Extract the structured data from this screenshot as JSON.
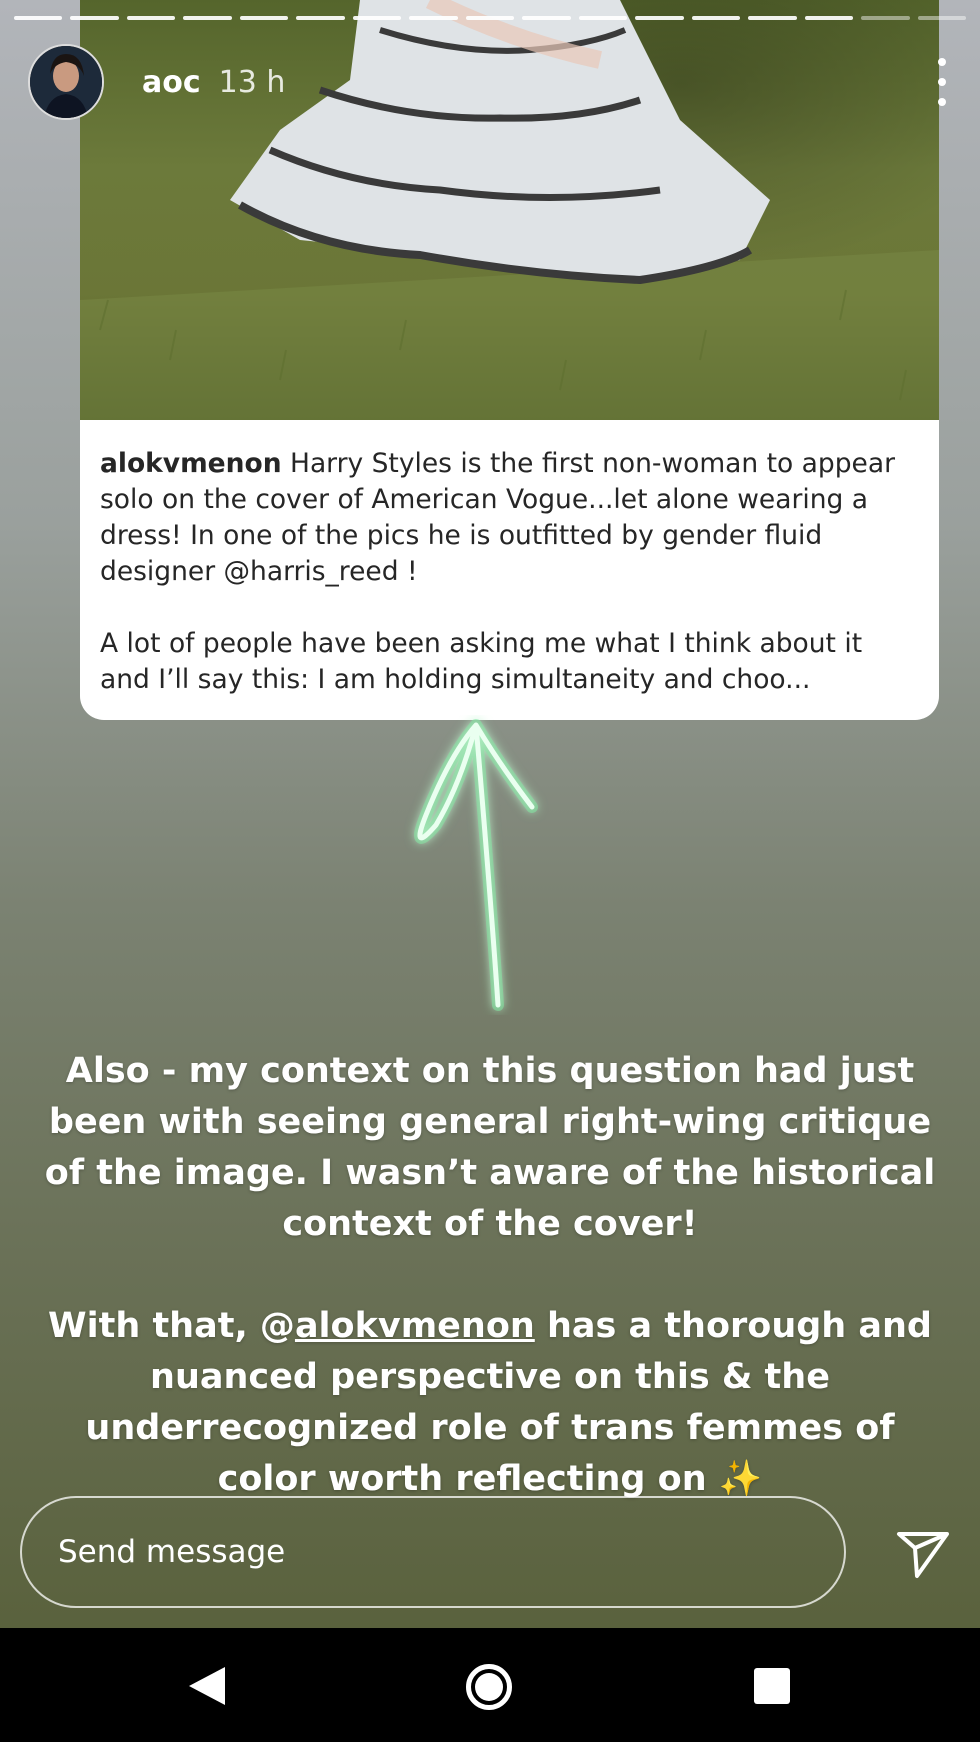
{
  "story": {
    "username": "aoc",
    "time": "13 h",
    "progress_total": 17,
    "progress_current": 15
  },
  "quoted_post": {
    "author": "alokvmenon",
    "paragraph1": " Harry Styles is the first non-woman to appear solo on the cover of American Vogue...let alone wearing a dress! In one of the pics he is outfitted by gender fluid designer @harris_reed !",
    "paragraph2": "A lot of people have been asking me what I think about it and I’ll say this: I am holding simultaneity and choo..."
  },
  "overlay_text": {
    "paragraph1": "Also - my context on this question had just been with seeing general right-wing critique of the image. I wasn’t aware of the historical context of the cover!",
    "paragraph2_before": "With that, @",
    "paragraph2_mention": "alokvmenon",
    "paragraph2_after": " has a thorough and nuanced perspective on this & the underrecognized role of trans femmes of color worth reflecting on ✨"
  },
  "reply": {
    "placeholder": "Send message"
  },
  "icons": {
    "more": "more-vertical-icon",
    "send": "send-paper-plane-icon",
    "back": "nav-back-icon",
    "home": "nav-home-icon",
    "recent": "nav-recents-icon"
  },
  "colors": {
    "arrow_glow": "#b6f5c8",
    "card_bg": "#ffffff",
    "text_dark": "#262626"
  }
}
